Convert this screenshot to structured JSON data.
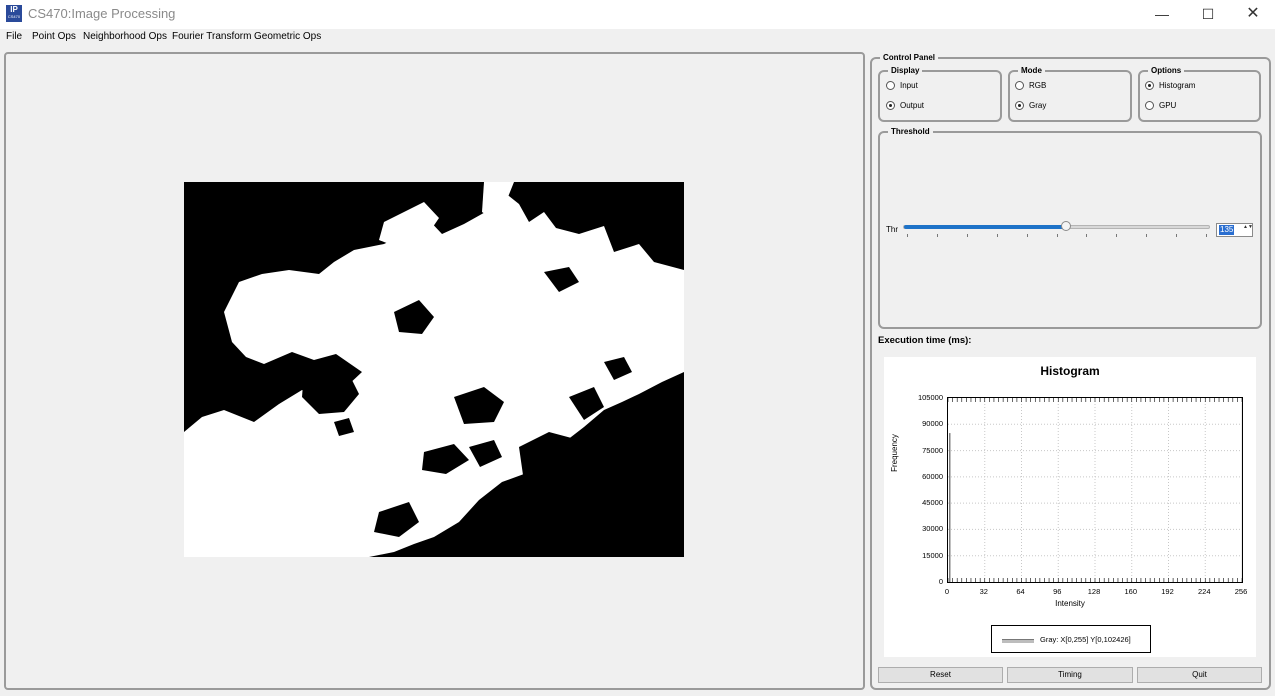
{
  "window": {
    "title": "CS470:Image Processing",
    "icon_text": "IP",
    "icon_subtext": "CS470",
    "minimize_glyph": "—",
    "maximize_glyph": "☐",
    "close_glyph": "✕"
  },
  "menubar": {
    "items": [
      "File",
      "Point Ops",
      "Neighborhood Ops",
      "Fourier Transform",
      "Geometric Ops"
    ]
  },
  "control_panel": {
    "title": "Control Panel",
    "display": {
      "title": "Display",
      "options": [
        "Input",
        "Output"
      ],
      "selected": "Output"
    },
    "mode": {
      "title": "Mode",
      "options": [
        "RGB",
        "Gray"
      ],
      "selected": "Gray"
    },
    "options": {
      "title": "Options",
      "options": [
        "Histogram",
        "GPU"
      ],
      "selected": "Histogram"
    },
    "threshold": {
      "title": "Threshold",
      "label": "Thr",
      "value": "135",
      "min": 0,
      "max": 255,
      "spin_arrows": "▲▼"
    },
    "execution_time_label": "Execution time (ms):"
  },
  "histogram": {
    "title": "Histogram",
    "legend": "Gray: X[0,255] Y[0,102426]"
  },
  "chart_data": {
    "type": "bar",
    "title": "Histogram",
    "xlabel": "Intensity",
    "ylabel": "Frequency",
    "xlim": [
      0,
      256
    ],
    "ylim": [
      0,
      105000
    ],
    "x_ticks": [
      "0",
      "32",
      "64",
      "96",
      "128",
      "160",
      "192",
      "224",
      "256"
    ],
    "y_ticks": [
      "105000",
      "90000",
      "75000",
      "60000",
      "45000",
      "30000",
      "15000",
      "0"
    ],
    "grid": true,
    "legend_position": "bottom",
    "series": [
      {
        "name": "Gray: X[0,255] Y[0,102426]",
        "color": "#808080",
        "x": [
          0,
          255
        ],
        "values": [
          85000,
          102426
        ]
      }
    ]
  },
  "buttons": {
    "reset": "Reset",
    "timing": "Timing",
    "quit": "Quit"
  },
  "colors": {
    "slider_fill": "#1e73c8",
    "groupbox_border": "#9a9a9a"
  }
}
